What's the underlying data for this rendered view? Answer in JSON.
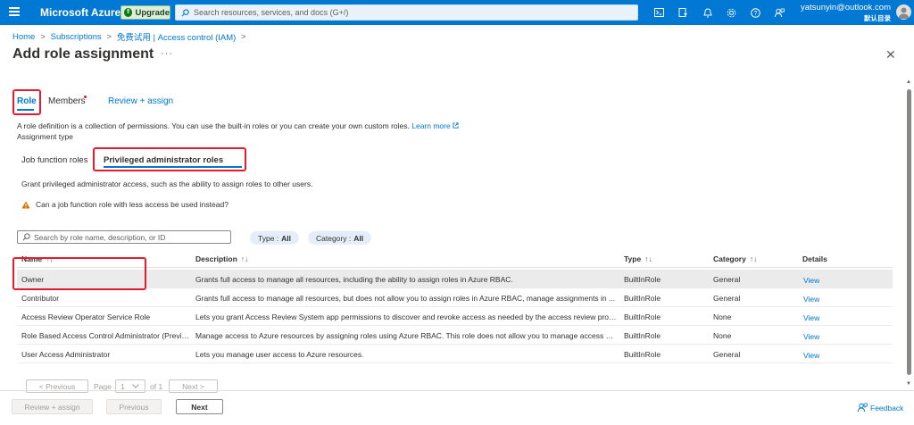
{
  "topbar": {
    "brand": "Microsoft Azure",
    "upgrade_label": "Upgrade",
    "search_placeholder": "Search resources, services, and docs (G+/)",
    "user_email": "yatsunyin@outlook.com",
    "user_directory": "默认目录",
    "accent_color": "#0078d4",
    "icons": [
      "cloud-shell-icon",
      "directory-filter-icon",
      "notifications-icon",
      "settings-icon",
      "help-icon",
      "feedback-icon"
    ]
  },
  "breadcrumb": [
    "Home",
    "Subscriptions",
    "免费试用 | Access control (IAM)"
  ],
  "page": {
    "title": "Add role assignment",
    "more": "···"
  },
  "tabs": [
    "Role",
    "Members",
    "Review + assign"
  ],
  "description": {
    "text": "A role definition is a collection of permissions. You can use the built-in roles or you can create your own custom roles.",
    "learn_more": "Learn more",
    "assignment_type": "Assignment type"
  },
  "subtabs": [
    "Job function roles",
    "Privileged administrator roles"
  ],
  "grant_text": "Grant privileged administrator access, such as the ability to assign roles to other users.",
  "warning_text": "Can a job function role with less access be used instead?",
  "filter": {
    "search_placeholder": "Search by role name, description, or ID",
    "type_label": "Type :",
    "type_value": "All",
    "category_label": "Category :",
    "category_value": "All"
  },
  "table": {
    "headers": [
      "Name",
      "Description",
      "Type",
      "Category",
      "Details"
    ],
    "sort_glyph": "↑↓",
    "rows": [
      {
        "name": "Owner",
        "description": "Grants full access to manage all resources, including the ability to assign roles in Azure RBAC.",
        "type": "BuiltInRole",
        "category": "General",
        "details": "View"
      },
      {
        "name": "Contributor",
        "description": "Grants full access to manage all resources, but does not allow you to assign roles in Azure RBAC, manage assignments in ...",
        "type": "BuiltInRole",
        "category": "General",
        "details": "View"
      },
      {
        "name": "Access Review Operator Service Role",
        "description": "Lets you grant Access Review System app permissions to discover and revoke access as needed by the access review proce...",
        "type": "BuiltInRole",
        "category": "None",
        "details": "View"
      },
      {
        "name": "Role Based Access Control Administrator (Previe...",
        "description": "Manage access to Azure resources by assigning roles using Azure RBAC. This role does not allow you to manage access us...",
        "type": "BuiltInRole",
        "category": "None",
        "details": "View"
      },
      {
        "name": "User Access Administrator",
        "description": "Lets you manage user access to Azure resources.",
        "type": "BuiltInRole",
        "category": "General",
        "details": "View"
      }
    ]
  },
  "pagination": {
    "previous": "< Previous",
    "page_label": "Page",
    "page_value": "1",
    "of_label": "of 1",
    "next": "Next >"
  },
  "footer": {
    "review_assign": "Review + assign",
    "previous": "Previous",
    "next": "Next",
    "feedback": "Feedback"
  }
}
